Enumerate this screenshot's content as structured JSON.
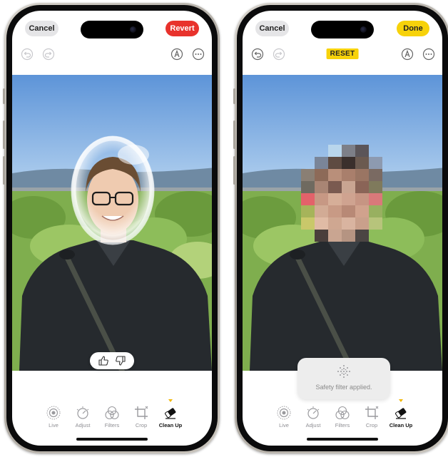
{
  "left_phone": {
    "cancel_label": "Cancel",
    "revert_label": "Revert",
    "feedback": {
      "thumbs_up": "thumbs-up-icon",
      "thumbs_down": "thumbs-down-icon"
    }
  },
  "right_phone": {
    "cancel_label": "Cancel",
    "done_label": "Done",
    "reset_label": "RESET",
    "toast_message": "Safety filter applied."
  },
  "tools": [
    {
      "label": "Live",
      "icon": "live-icon"
    },
    {
      "label": "Adjust",
      "icon": "adjust-icon"
    },
    {
      "label": "Filters",
      "icon": "filters-icon"
    },
    {
      "label": "Crop",
      "icon": "crop-icon"
    },
    {
      "label": "Clean Up",
      "icon": "eraser-icon"
    }
  ],
  "active_tool": "Clean Up",
  "colors": {
    "revert": "#e8322c",
    "done": "#f7d20a",
    "reset": "#f7d20a",
    "active_indicator": "#f2b705",
    "inactive_label": "#8e8e93"
  }
}
